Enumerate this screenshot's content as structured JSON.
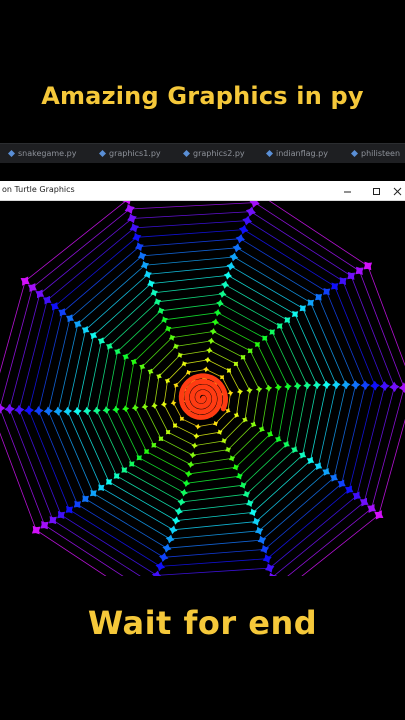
{
  "captions": {
    "top": "Amazing Graphics in py",
    "bottom": "Wait for end"
  },
  "editor_tabs": [
    {
      "label": "snakegame.py"
    },
    {
      "label": "graphics1.py"
    },
    {
      "label": "graphics2.py"
    },
    {
      "label": "indianflag.py"
    },
    {
      "label": "philisteen"
    }
  ],
  "turtle_window": {
    "title": "on Turtle Graphics",
    "buttons": [
      "minimize",
      "maximize",
      "close"
    ]
  },
  "colors": {
    "caption": "#f5c83a",
    "tab_icon": "#5a8fd6",
    "background": "#000000"
  },
  "icons": [
    "python-file-icon",
    "minimize-icon",
    "maximize-icon",
    "close-icon"
  ]
}
